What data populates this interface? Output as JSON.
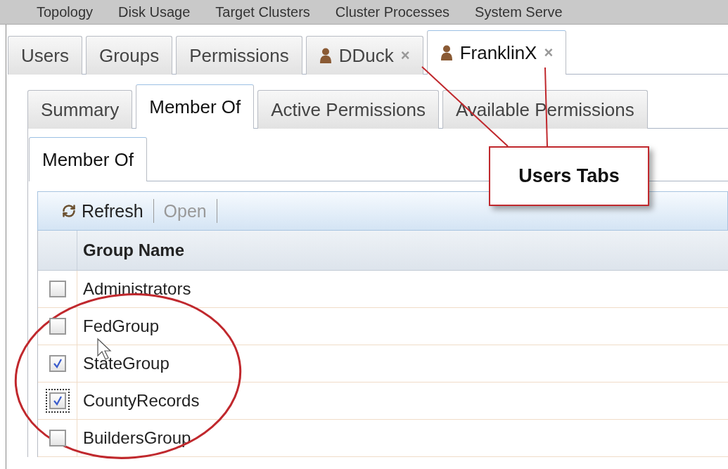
{
  "top_menu": [
    "Topology",
    "Disk Usage",
    "Target Clusters",
    "Cluster Processes",
    "System Serve"
  ],
  "user_tabs": [
    {
      "label": "Users",
      "kind": "plain",
      "selected": false
    },
    {
      "label": "Groups",
      "kind": "plain",
      "selected": false
    },
    {
      "label": "Permissions",
      "kind": "plain",
      "selected": false
    },
    {
      "label": "DDuck",
      "kind": "user",
      "selected": false,
      "close": "×"
    },
    {
      "label": "FranklinX",
      "kind": "user",
      "selected": true,
      "close": "×"
    }
  ],
  "detail_tabs": [
    {
      "label": "Summary",
      "selected": false
    },
    {
      "label": "Member Of",
      "selected": true
    },
    {
      "label": "Active Permissions",
      "selected": false
    },
    {
      "label": "Available Permissions",
      "selected": false
    }
  ],
  "panel_tab": {
    "label": "Member Of"
  },
  "toolbar": [
    {
      "label": "Refresh",
      "kind": "refresh",
      "disabled": false
    },
    {
      "label": "Open",
      "kind": "plain",
      "disabled": true
    }
  ],
  "grid": {
    "columns": [
      "Group Name"
    ],
    "rows": [
      {
        "name": "Administrators",
        "checked": false,
        "focused": false
      },
      {
        "name": "FedGroup",
        "checked": false,
        "focused": false
      },
      {
        "name": "StateGroup",
        "checked": true,
        "focused": false
      },
      {
        "name": "CountyRecords",
        "checked": true,
        "focused": true
      },
      {
        "name": "BuildersGroup",
        "checked": false,
        "focused": false
      }
    ]
  },
  "callout": {
    "label": "Users Tabs"
  }
}
